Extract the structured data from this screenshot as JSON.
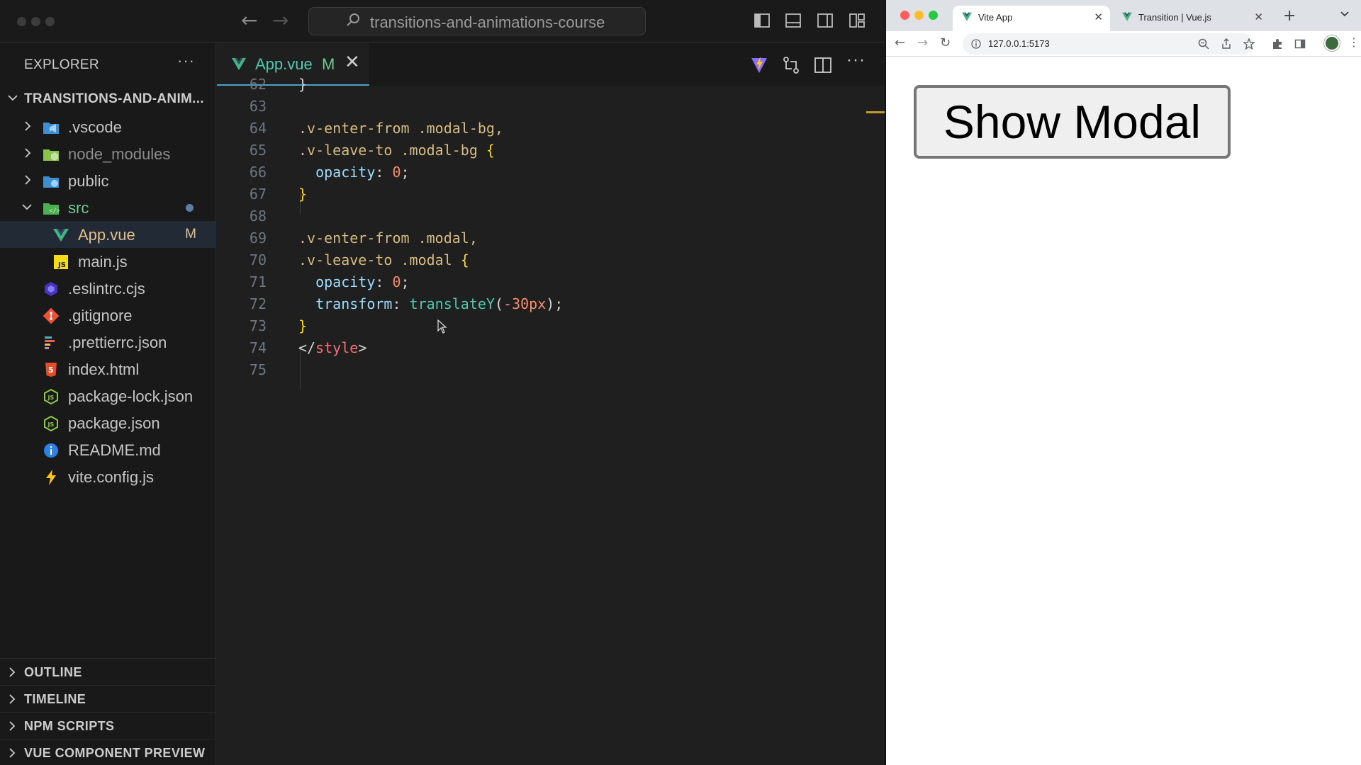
{
  "vscode": {
    "search_text": "transitions-and-animations-course",
    "explorer_title": "EXPLORER",
    "explorer_more": "···",
    "root_folder": "TRANSITIONS-AND-ANIM...",
    "tree": [
      {
        "label": "public",
        "icon": "folder-public-icon"
      },
      {
        "label": "src",
        "icon": "folder-src-icon"
      },
      {
        "label": "App.vue",
        "icon": "vue-icon",
        "badge": "M"
      },
      {
        "label": "main.js",
        "icon": "js-icon"
      },
      {
        "label": ".eslintrc.cjs",
        "icon": "eslint-icon"
      },
      {
        "label": ".gitignore",
        "icon": "git-icon"
      },
      {
        "label": ".prettierrc.json",
        "icon": "prettier-icon"
      },
      {
        "label": "index.html",
        "icon": "html-icon"
      },
      {
        "label": "package-lock.json",
        "icon": "node-icon"
      },
      {
        "label": "package.json",
        "icon": "node-icon"
      },
      {
        "label": "README.md",
        "icon": "info-icon"
      },
      {
        "label": "vite.config.js",
        "icon": "vite-icon"
      },
      {
        "label": ".vscode",
        "icon": "folder-vscode-icon"
      },
      {
        "label": "node_modules",
        "icon": "folder-node-icon"
      }
    ],
    "sections": [
      "OUTLINE",
      "TIMELINE",
      "NPM SCRIPTS",
      "VUE COMPONENT PREVIEW"
    ],
    "tab": {
      "name": "App.vue",
      "modified": "M",
      "close": "✕"
    },
    "code_lines": [
      {
        "n": "62",
        "t": "}"
      },
      {
        "n": "63",
        "t": ""
      },
      {
        "n": "64",
        "t": ".v-enter-from .modal-bg,"
      },
      {
        "n": "65",
        "t": ".v-leave-to .modal-bg {"
      },
      {
        "n": "66",
        "t": "  opacity: 0;"
      },
      {
        "n": "67",
        "t": "}"
      },
      {
        "n": "68",
        "t": ""
      },
      {
        "n": "69",
        "t": ".v-enter-from .modal,"
      },
      {
        "n": "70",
        "t": ".v-leave-to .modal {"
      },
      {
        "n": "71",
        "t": "  opacity: 0;"
      },
      {
        "n": "72",
        "t": "  transform: translateY(-30px);"
      },
      {
        "n": "73",
        "t": "}"
      },
      {
        "n": "74",
        "t": "</style>"
      },
      {
        "n": "75",
        "t": ""
      }
    ]
  },
  "browser": {
    "tabs": [
      {
        "title": "Vite App",
        "close": "✕"
      },
      {
        "title": "Transition | Vue.js",
        "close": "✕"
      }
    ],
    "new_tab": "+",
    "url": "127.0.0.1:5173",
    "page_button": "Show Modal"
  },
  "colors": {
    "vscode_bg": "#1f1f1f",
    "vue_green": "#41b883",
    "modified": "#e2c08d",
    "browser_button_bg": "#efefef"
  }
}
